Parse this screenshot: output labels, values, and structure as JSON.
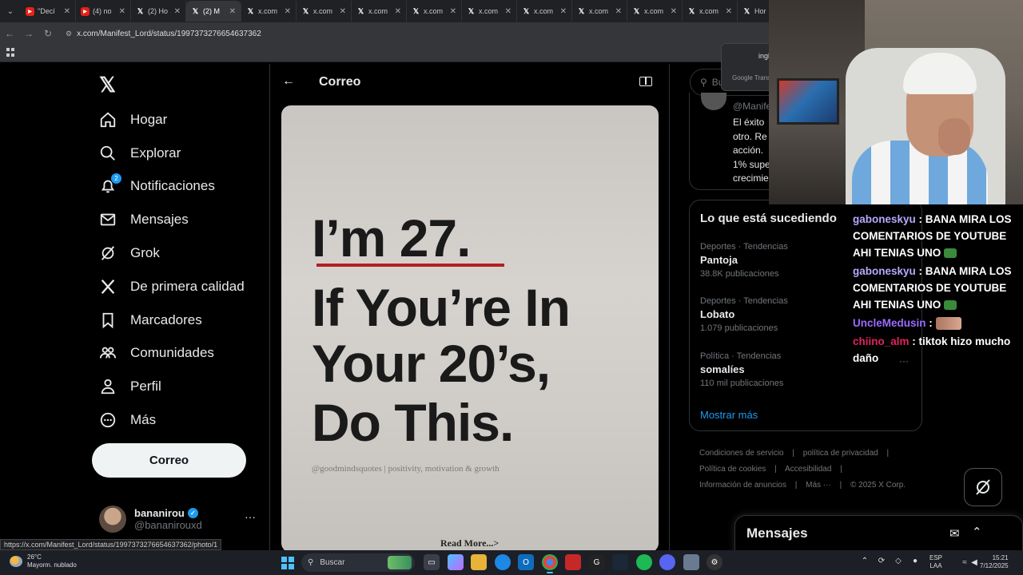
{
  "browser": {
    "tabs": [
      {
        "title": "\"Decí",
        "favicon": "youtube",
        "close": "✕"
      },
      {
        "title": "(4) no",
        "favicon": "youtube",
        "close": "✕"
      },
      {
        "title": "(2) Ho",
        "favicon": "x",
        "close": "✕"
      },
      {
        "title": "(2) M",
        "favicon": "x",
        "close": "✕",
        "active": true
      },
      {
        "title": "x.com",
        "favicon": "x",
        "close": "✕"
      },
      {
        "title": "x.com",
        "favicon": "x",
        "close": "✕"
      },
      {
        "title": "x.com",
        "favicon": "x",
        "close": "✕"
      },
      {
        "title": "x.com",
        "favicon": "x",
        "close": "✕"
      },
      {
        "title": "x.com",
        "favicon": "x",
        "close": "✕"
      },
      {
        "title": "x.com",
        "favicon": "x",
        "close": "✕"
      },
      {
        "title": "x.com",
        "favicon": "x",
        "close": "✕"
      },
      {
        "title": "x.com",
        "favicon": "x",
        "close": "✕"
      },
      {
        "title": "x.com",
        "favicon": "x",
        "close": "✕"
      },
      {
        "title": "Hor",
        "favicon": "x",
        "close": ""
      }
    ],
    "url": "x.com/Manifest_Lord/status/1997373276654637362",
    "status_url": "https://x.com/Manifest_Lord/status/1997373276654637362/photo/1"
  },
  "translate": {
    "lang": "ingl",
    "brand": "Google Trans"
  },
  "sidebar": {
    "logo": "𝕏",
    "items": [
      {
        "label": "Hogar",
        "icon": "home-icon"
      },
      {
        "label": "Explorar",
        "icon": "search-icon"
      },
      {
        "label": "Notificaciones",
        "icon": "bell-icon",
        "badge": "2"
      },
      {
        "label": "Mensajes",
        "icon": "mail-icon"
      },
      {
        "label": "Grok",
        "icon": "grok-icon"
      },
      {
        "label": "De primera calidad",
        "icon": "x-icon"
      },
      {
        "label": "Marcadores",
        "icon": "bookmark-icon"
      },
      {
        "label": "Comunidades",
        "icon": "communities-icon"
      },
      {
        "label": "Perfil",
        "icon": "person-icon"
      },
      {
        "label": "Más",
        "icon": "more-circle-icon"
      }
    ],
    "post_button": "Correo",
    "profile": {
      "name": "bananirou",
      "handle": "@bananirouxd",
      "more": "···"
    }
  },
  "main": {
    "title": "Correo",
    "image": {
      "lines": [
        "I’m 27.",
        "If You’re In",
        "Your 20’s,",
        "Do This."
      ],
      "signature": "@goodmindsquotes | positivity, motivation & growth",
      "read_more": "Read More...>"
    }
  },
  "right": {
    "search_placeholder": "Bu",
    "top_card": {
      "handle": "@Manife",
      "text": "El éxito\notro. Re\nacción.\n1% supe\ncrecimie"
    },
    "trends": {
      "heading": "Lo que está sucediendo",
      "items": [
        {
          "category": "Deportes · Tendencias",
          "name": "Pantoja",
          "count": "38.8K publicaciones"
        },
        {
          "category": "Deportes · Tendencias",
          "name": "Lobato",
          "count": "1.079 publicaciones"
        },
        {
          "category": "Política · Tendencias",
          "name": "somalíes",
          "count": "110 mil publicaciones"
        }
      ],
      "show_more": "Mostrar más"
    },
    "footer": {
      "line1": [
        "Condiciones de servicio",
        "política de privacidad"
      ],
      "line2": [
        "Política de cookies",
        "Accesibilidad"
      ],
      "line3": [
        "Información de anuncios",
        "Más ···",
        "© 2025 X Corp."
      ],
      "separator": "|"
    },
    "messages_drawer": "Mensajes"
  },
  "chat": [
    {
      "user": "gaboneskyu",
      "color": "#b9a7ff",
      "text": "BANA MIRA LOS COMENTARIOS DE YOUTUBE AHI TENIAS UNO"
    },
    {
      "user": "gaboneskyu",
      "color": "#b9a7ff",
      "text": "BANA MIRA LOS COMENTARIOS DE YOUTUBE AHI TENIAS UNO"
    },
    {
      "user": "UncleMedusin",
      "color": "#9b6bff",
      "text": ""
    },
    {
      "user": "chiino_alm",
      "color": "#e0245e",
      "text": "tiktok hizo mucho daño"
    }
  ],
  "chat_separator": " : ",
  "taskbar": {
    "weather_temp": "26°C",
    "weather_desc": "Mayorm. nublado",
    "search_label": "Buscar",
    "lang_top": "ESP",
    "lang_bottom": "LAA",
    "time": "15:21",
    "date": "7/12/2025"
  }
}
